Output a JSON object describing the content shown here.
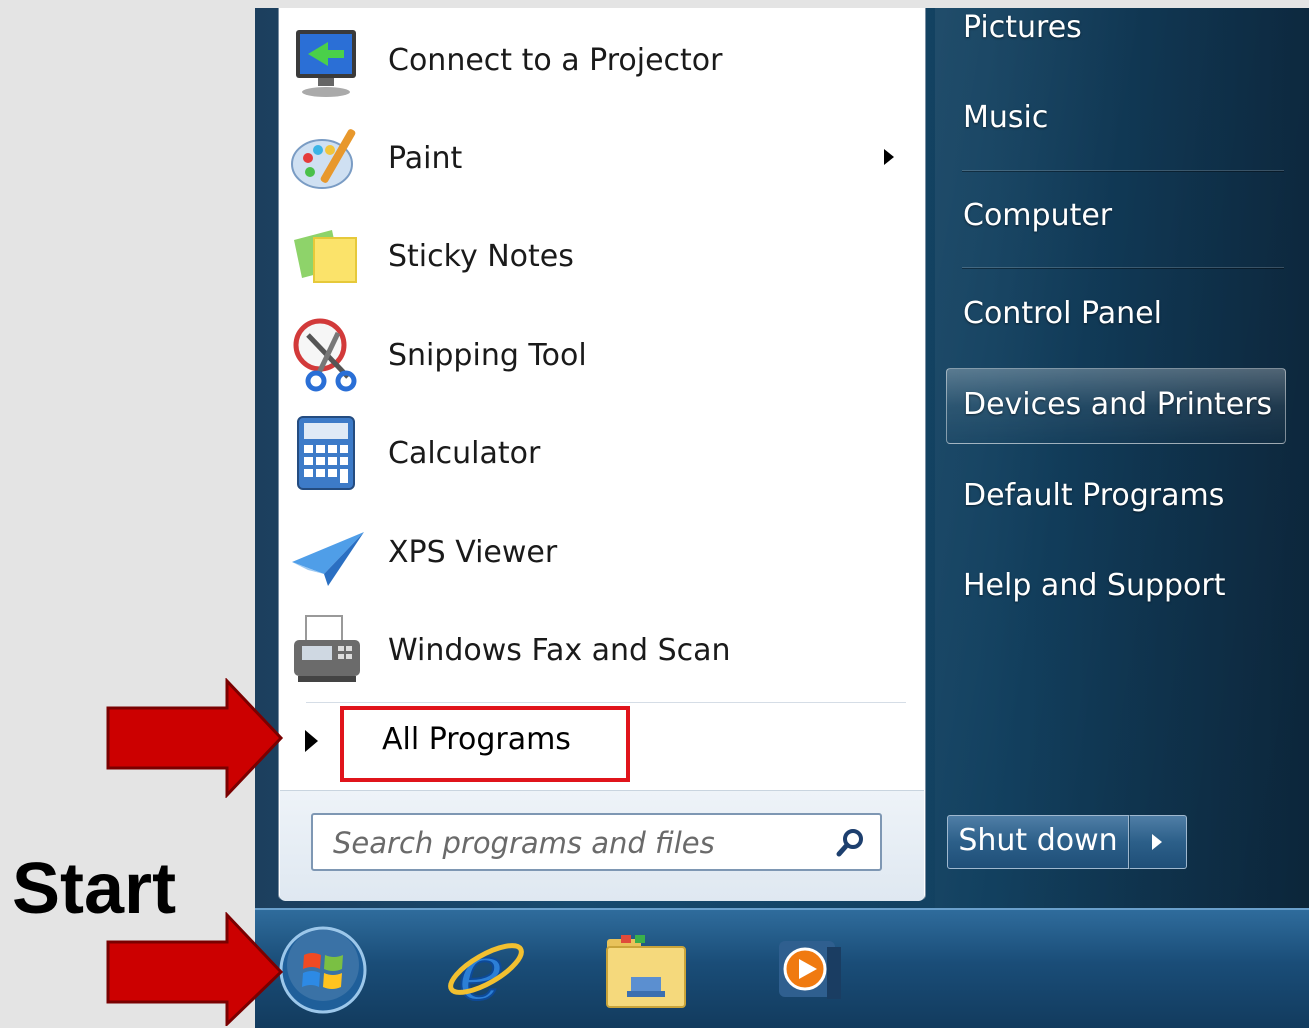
{
  "annotation": {
    "start_label": "Start"
  },
  "left_pane": {
    "programs": [
      {
        "label": "Connect to a Projector",
        "icon": "projector-icon",
        "has_submenu": false
      },
      {
        "label": "Paint",
        "icon": "paint-palette-icon",
        "has_submenu": true
      },
      {
        "label": "Sticky Notes",
        "icon": "sticky-notes-icon",
        "has_submenu": false
      },
      {
        "label": "Snipping Tool",
        "icon": "scissors-icon",
        "has_submenu": false
      },
      {
        "label": "Calculator",
        "icon": "calculator-icon",
        "has_submenu": false
      },
      {
        "label": "XPS Viewer",
        "icon": "paper-plane-icon",
        "has_submenu": false
      },
      {
        "label": "Windows Fax and Scan",
        "icon": "fax-icon",
        "has_submenu": false
      }
    ],
    "all_programs": "All Programs",
    "search": {
      "placeholder": "Search programs and files"
    }
  },
  "right_pane": {
    "items": [
      {
        "label": "Pictures"
      },
      {
        "label": "Music"
      },
      {
        "label": "Computer"
      },
      {
        "label": "Control Panel"
      },
      {
        "label": "Devices and Printers",
        "highlighted": true
      },
      {
        "label": "Default Programs"
      },
      {
        "label": "Help and Support"
      }
    ],
    "shutdown_label": "Shut down"
  },
  "taskbar": {
    "icons": [
      "windows-start-orb-icon",
      "internet-explorer-icon",
      "windows-explorer-folder-icon",
      "media-player-icon"
    ]
  },
  "colors": {
    "highlight_box": "#e0141b",
    "annotation_arrow": "#cc0000"
  }
}
